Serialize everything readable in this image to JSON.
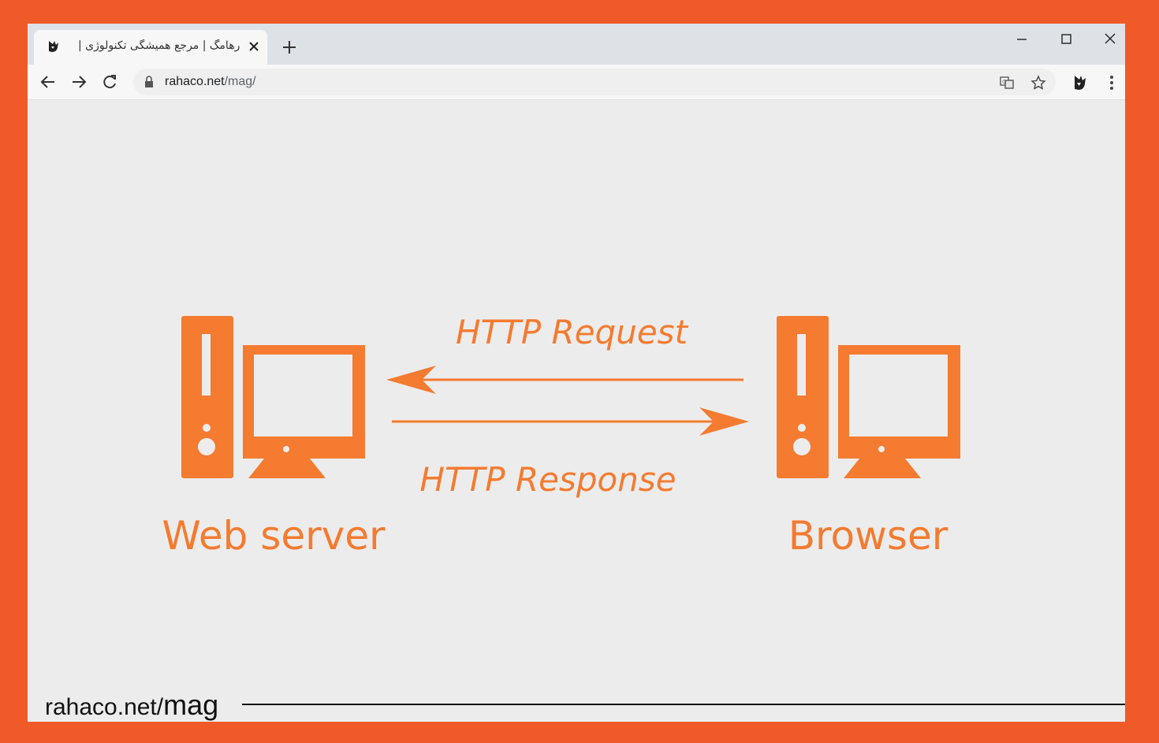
{
  "tab": {
    "title": "رهامگ | مرجع همیشگی تکنولوژی |",
    "favicon": "rahaco-logo-icon"
  },
  "toolbar": {
    "url_host": "rahaco.net",
    "url_path": "/mag/"
  },
  "diagram": {
    "request_label": "HTTP Request",
    "response_label": "HTTP Response",
    "server_label": "Web server",
    "browser_label": "Browser",
    "accent_color": "#f47b30"
  },
  "footer": {
    "site": "rahaco.net/",
    "section": "mag"
  },
  "colors": {
    "frame": "#f05a28",
    "background": "#ececec",
    "tabstrip": "#dee1e6"
  }
}
